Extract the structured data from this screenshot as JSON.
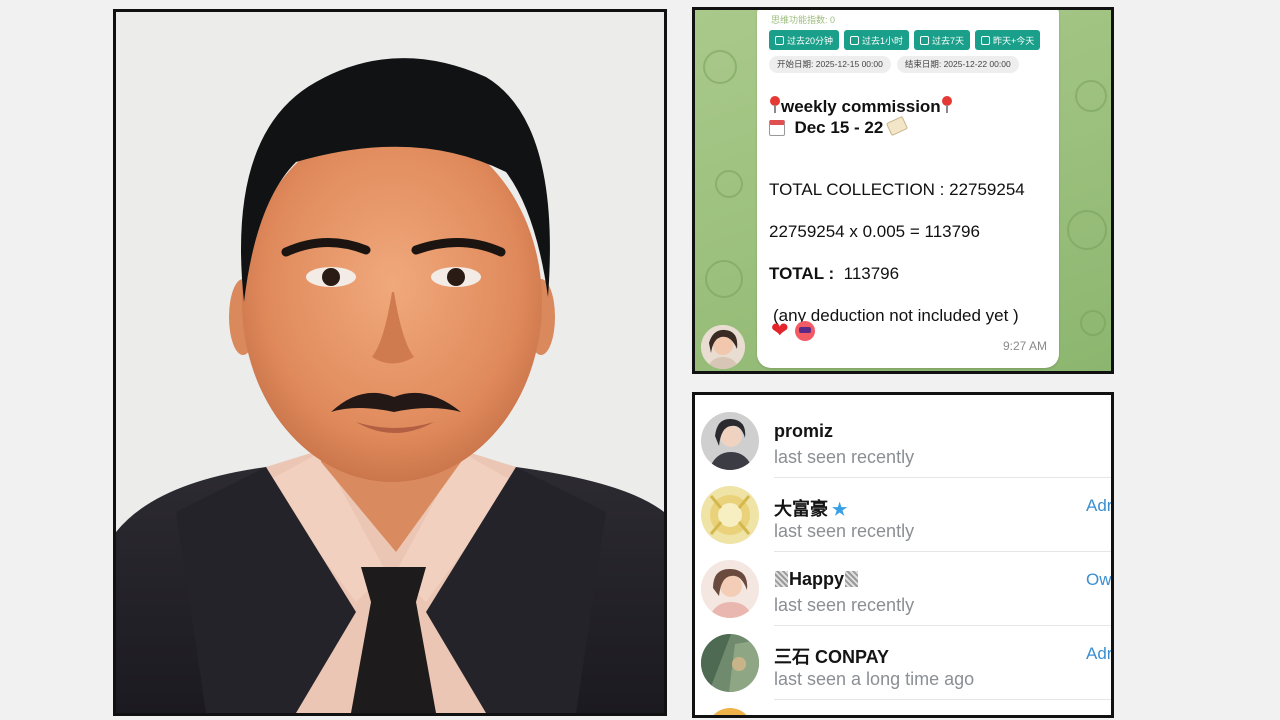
{
  "chat": {
    "cut_text": "思维功能指数: 0",
    "quick_buttons": [
      "过去20分钟",
      "过去1小时",
      "过去7天",
      "昨天+今天"
    ],
    "start_chip": "开始日期:   2025-12-15 00:00",
    "end_chip": "结束日期:   2025-12-22 00:00",
    "heading": "weekly commission",
    "date_range": "Dec 15 - 22",
    "line_total_collection": "TOTAL COLLECTION : 22759254",
    "line_formula": "22759254  x 0.005  =  113796",
    "total_label": "TOTAL :",
    "total_value": "113796",
    "note": "(any deduction not included yet )",
    "time": "9:27 AM"
  },
  "members": [
    {
      "name": "promiz",
      "status": "last seen recently",
      "role": ""
    },
    {
      "name": "大富豪",
      "status": "last seen recently",
      "role": "Adr"
    },
    {
      "name": "Happy",
      "status": "last seen recently",
      "role": "Ow"
    },
    {
      "name": "三石 CONPAY",
      "status": "last seen a long time ago",
      "role": "Adr"
    }
  ],
  "colors": {
    "accent_teal": "#1aa08a",
    "link_blue": "#3b8fd1",
    "chat_bg": "#9cc07e"
  },
  "icons": [
    "pin-icon",
    "calendar-icon",
    "tag-icon",
    "heart-reaction-icon",
    "emoji-reaction-icon",
    "star-icon"
  ]
}
